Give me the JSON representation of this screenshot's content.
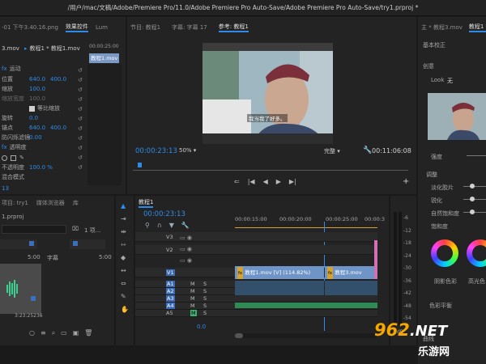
{
  "title": "/用户/mac/文稿/Adobe/Premiere Pro/11.0/Adobe Premiere Pro Auto-Save/Adobe Premiere Pro Auto-Save/try1.prproj *",
  "effect_controls": {
    "file_label": "-01 下午3.40.16.png",
    "tabs": [
      "效果控件",
      "Lum"
    ],
    "menu_icon": "double-arrow-icon",
    "source": "3.mov",
    "sequence": "教程1 * 教程1.mov",
    "timecode_mark": "00:00:25:00",
    "clip_name": "教程1.mov",
    "motion_label": "运动",
    "position_label": "位置",
    "position_x": "640.0",
    "position_y": "400.0",
    "scale_label": "缩放",
    "scale_value": "100.0",
    "scale_width_label": "缩放宽度",
    "scale_width_value": "100.0",
    "uniform_label": "等比缩放",
    "rotation_label": "旋转",
    "rotation_value": "0.0",
    "anchor_label": "锚点",
    "anchor_x": "640.0",
    "anchor_y": "400.0",
    "flicker_label": "防闪烁滤镜",
    "flicker_value": "0.00",
    "opacity_section_label": "透明度",
    "opacity_label": "不透明度",
    "opacity_value": "100.0 %",
    "blend_label": "混合模式",
    "timecode": "13"
  },
  "program": {
    "tabs": [
      "节目: 教程1",
      "字幕: 字幕 17",
      "参考: 教程1"
    ],
    "subtitle": "我当我了好多。",
    "timecode": "00:00:23:13",
    "zoom": "50%",
    "quality": "完整",
    "duration": "00:11:06:08"
  },
  "right": {
    "tabs": [
      "主 * 教程3.mov",
      "教程1 * 教程3.mov"
    ],
    "section": "基本校正",
    "creative": "创意",
    "look_label": "Look",
    "look_value": "无",
    "intensity": "强度",
    "adjust": "调整",
    "faded": "淡化胶片",
    "sharpen": "锐化",
    "vibrance": "自然饱和度",
    "saturation": "饱和度",
    "shadow_tint": "阴影色彩",
    "highlight_tint": "高光色",
    "tint_balance": "色彩平衡",
    "curves": "曲线"
  },
  "project": {
    "tabs": [
      "项目: try1",
      "媒体浏览器",
      "库"
    ],
    "project_file": "1.prproj",
    "items_count": "1 项...",
    "thumb1_duration": "5:00",
    "thumb2_name": "字幕",
    "thumb2_duration": "5:00",
    "thumb3_duration": "3:23:25236",
    "in_out_label": "13"
  },
  "timeline": {
    "tab": "教程1",
    "timecode": "00:00:23:13",
    "ruler": [
      "00:00:15:00",
      "00:00:20:00",
      "00:00:25:00",
      "00:00:3"
    ],
    "video_tracks": [
      "V3",
      "V2",
      "V1"
    ],
    "audio_tracks": [
      "A1",
      "A2",
      "A3",
      "A4",
      "A5"
    ],
    "source_patch_v": "V1",
    "source_patch_a": "A1",
    "clip1": "教程1.mov [V] (114.82%)",
    "clip2": "教程3.mov",
    "clip_fx": "fx",
    "master_label": "0.0",
    "mute": "M",
    "solo": "S",
    "meter_scale": [
      "-6",
      "-12",
      "-18",
      "-24",
      "-30",
      "-36",
      "-42",
      "-48",
      "-54"
    ],
    "meter_db": "dB",
    "watermark_primary": "962",
    "watermark_secondary": ".NET",
    "watermark_cn": "乐游网"
  },
  "colors": {
    "accent": "#2d8ceb",
    "timecode": "#2d8ceb",
    "video_clip": "#6f94c7",
    "audio_clip": "#2f8a56",
    "fx": "#d3a230",
    "sequence_pink": "#d26fb5",
    "watermark": "#f7a700"
  },
  "icons": [
    "hand-icon",
    "selection-arrow-icon",
    "track-select-icon",
    "ripple-edit-icon",
    "razor-icon",
    "slip-icon",
    "pen-icon",
    "zoom-icon",
    "type-icon",
    "wrench-icon",
    "play-icon",
    "step-back-icon",
    "step-forward-icon",
    "add-marker-icon",
    "reset-icon",
    "lock-icon",
    "eye-icon",
    "mic-icon"
  ]
}
